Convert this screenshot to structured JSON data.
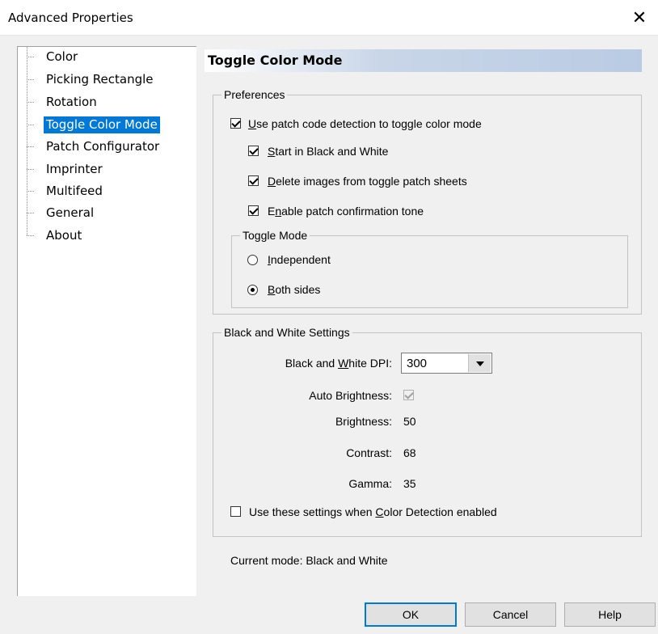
{
  "window": {
    "title": "Advanced Properties",
    "close_glyph": "✕"
  },
  "tree": {
    "items": [
      {
        "label": "Color"
      },
      {
        "label": "Picking Rectangle"
      },
      {
        "label": "Rotation"
      },
      {
        "label": "Toggle Color Mode",
        "selected": true
      },
      {
        "label": "Patch Configurator"
      },
      {
        "label": "Imprinter"
      },
      {
        "label": "Multifeed"
      },
      {
        "label": "General"
      },
      {
        "label": "About"
      }
    ]
  },
  "panel": {
    "title": "Toggle Color Mode"
  },
  "preferences": {
    "legend": "Preferences",
    "use_patch": {
      "label_pre": "",
      "mnemonic": "U",
      "label_post": "se patch code detection to toggle color mode",
      "checked": true
    },
    "start_bw": {
      "label_pre": "",
      "mnemonic": "S",
      "label_post": "tart in Black and White",
      "checked": true
    },
    "delete_images": {
      "label_pre": "",
      "mnemonic": "D",
      "label_post": "elete images from toggle patch sheets",
      "checked": true
    },
    "enable_tone": {
      "label_pre": "E",
      "mnemonic": "n",
      "label_post": "able patch confirmation tone",
      "checked": true
    },
    "toggle_mode": {
      "legend": "Toggle Mode",
      "independent": {
        "label_pre": "",
        "mnemonic": "I",
        "label_post": "ndependent",
        "selected": false
      },
      "both_sides": {
        "label_pre": "",
        "mnemonic": "B",
        "label_post": "oth sides",
        "selected": true
      }
    }
  },
  "bw_settings": {
    "legend": "Black and White Settings",
    "dpi": {
      "label_pre": "Black and ",
      "mnemonic": "W",
      "label_post": "hite DPI:",
      "value": "300"
    },
    "auto_brightness": {
      "label": "Auto Brightness:",
      "checked": true,
      "disabled": true
    },
    "brightness": {
      "label": "Brightness:",
      "value": "50"
    },
    "contrast": {
      "label": "Contrast:",
      "value": "68"
    },
    "gamma": {
      "label": "Gamma:",
      "value": "35"
    },
    "use_when_color": {
      "label_pre": "Use these settings when ",
      "mnemonic": "C",
      "label_post": "olor Detection enabled",
      "checked": false
    }
  },
  "status": {
    "current_mode": "Current mode: Black and White"
  },
  "buttons": {
    "ok": "OK",
    "cancel": "Cancel",
    "help": "Help"
  }
}
